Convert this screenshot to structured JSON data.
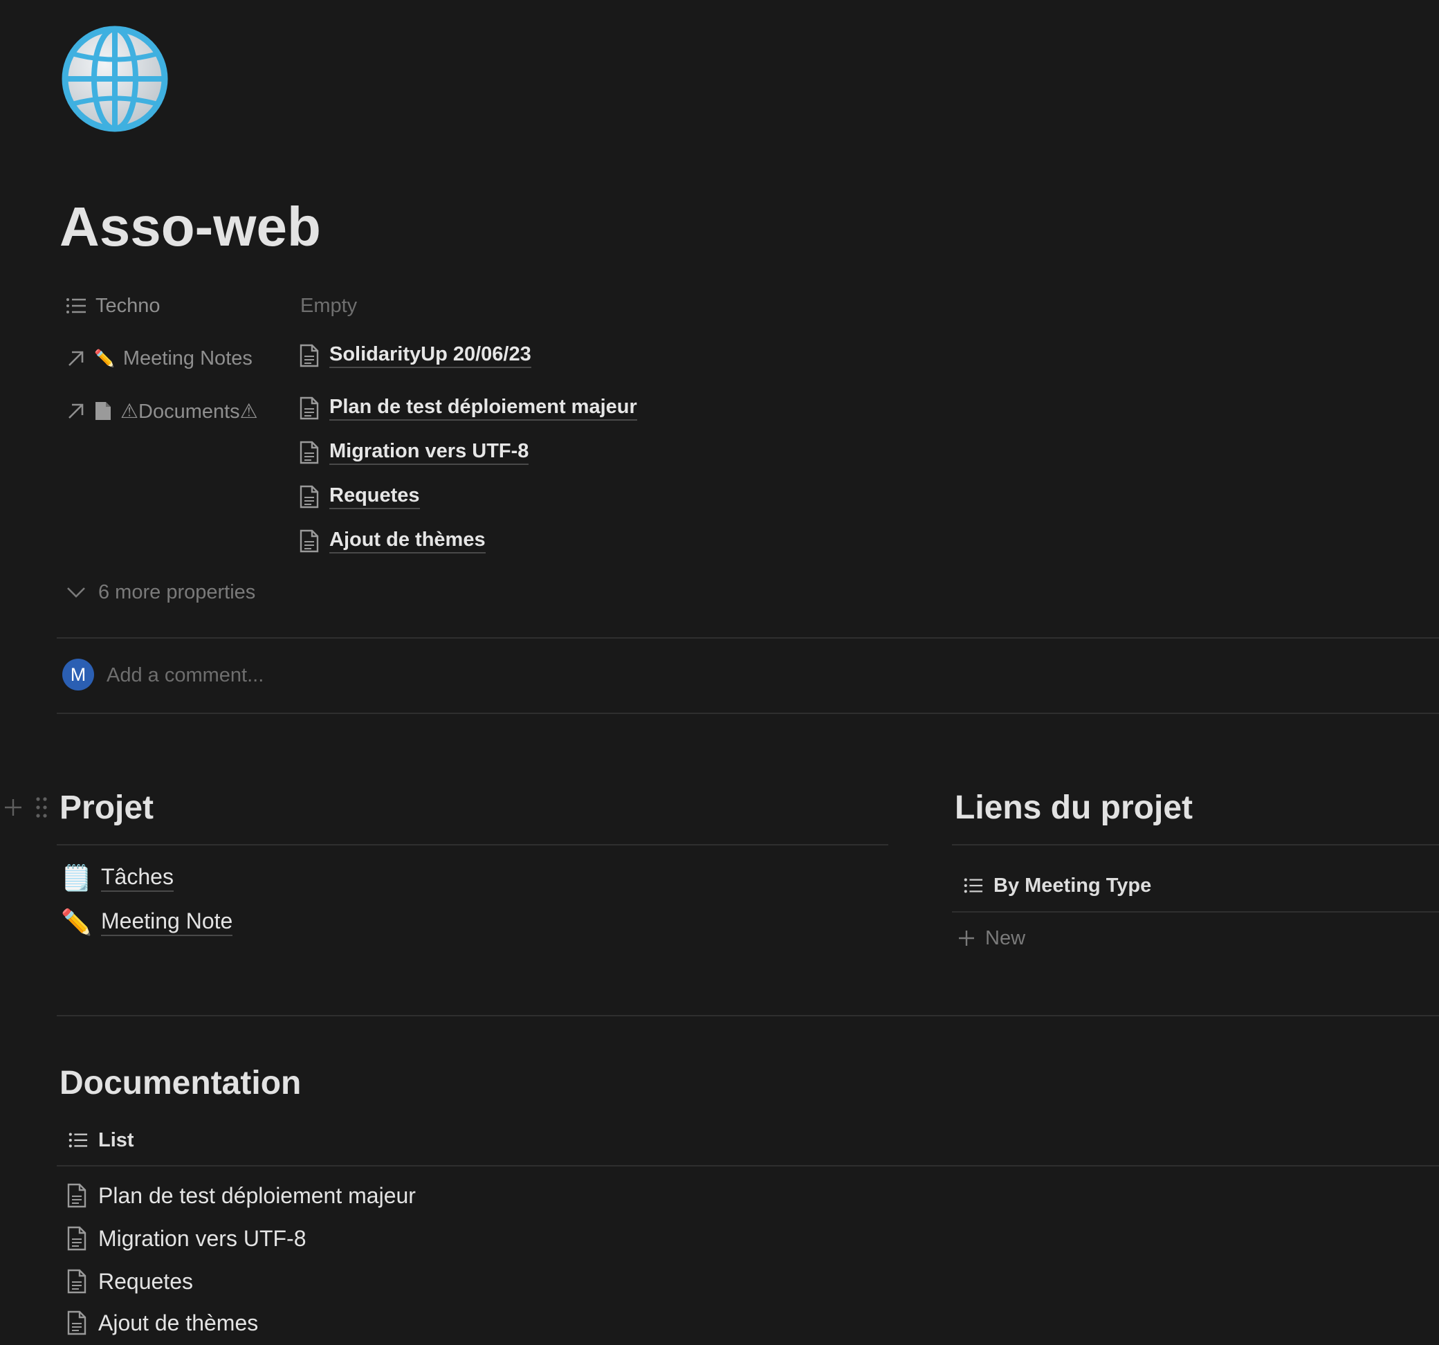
{
  "page": {
    "icon": "globe-icon",
    "title": "Asso-web"
  },
  "properties": [
    {
      "icon": "list-icon",
      "name": "Techno",
      "empty_text": "Empty"
    },
    {
      "icon": "arrow-up-right-icon",
      "emoji": "✏️",
      "name": "Meeting Notes",
      "values": [
        "SolidarityUp 20/06/23"
      ]
    },
    {
      "icon": "arrow-up-right-icon",
      "emoji": "📄",
      "name": "⚠Documents⚠",
      "values": [
        "Plan de test déploiement majeur",
        "Migration vers UTF-8",
        "Requetes",
        "Ajout de thèmes"
      ]
    }
  ],
  "more_properties": "6 more properties",
  "comment": {
    "avatar_letter": "M",
    "placeholder": "Add a comment..."
  },
  "projet": {
    "heading": "Projet",
    "links": [
      {
        "emoji": "🗒️",
        "label": "Tâches"
      },
      {
        "emoji": "✏️",
        "label": "Meeting Note"
      }
    ]
  },
  "liens": {
    "heading": "Liens du projet",
    "view_label": "By Meeting Type",
    "new_label": "New"
  },
  "documentation": {
    "heading": "Documentation",
    "view_label": "List",
    "items": [
      "Plan de test déploiement majeur",
      "Migration vers UTF-8",
      "Requetes",
      "Ajout de thèmes"
    ]
  },
  "colors": {
    "background": "#191919",
    "text": "#d4d4d4",
    "avatar": "#2b5fb3",
    "globe": "#4fb8e6"
  }
}
